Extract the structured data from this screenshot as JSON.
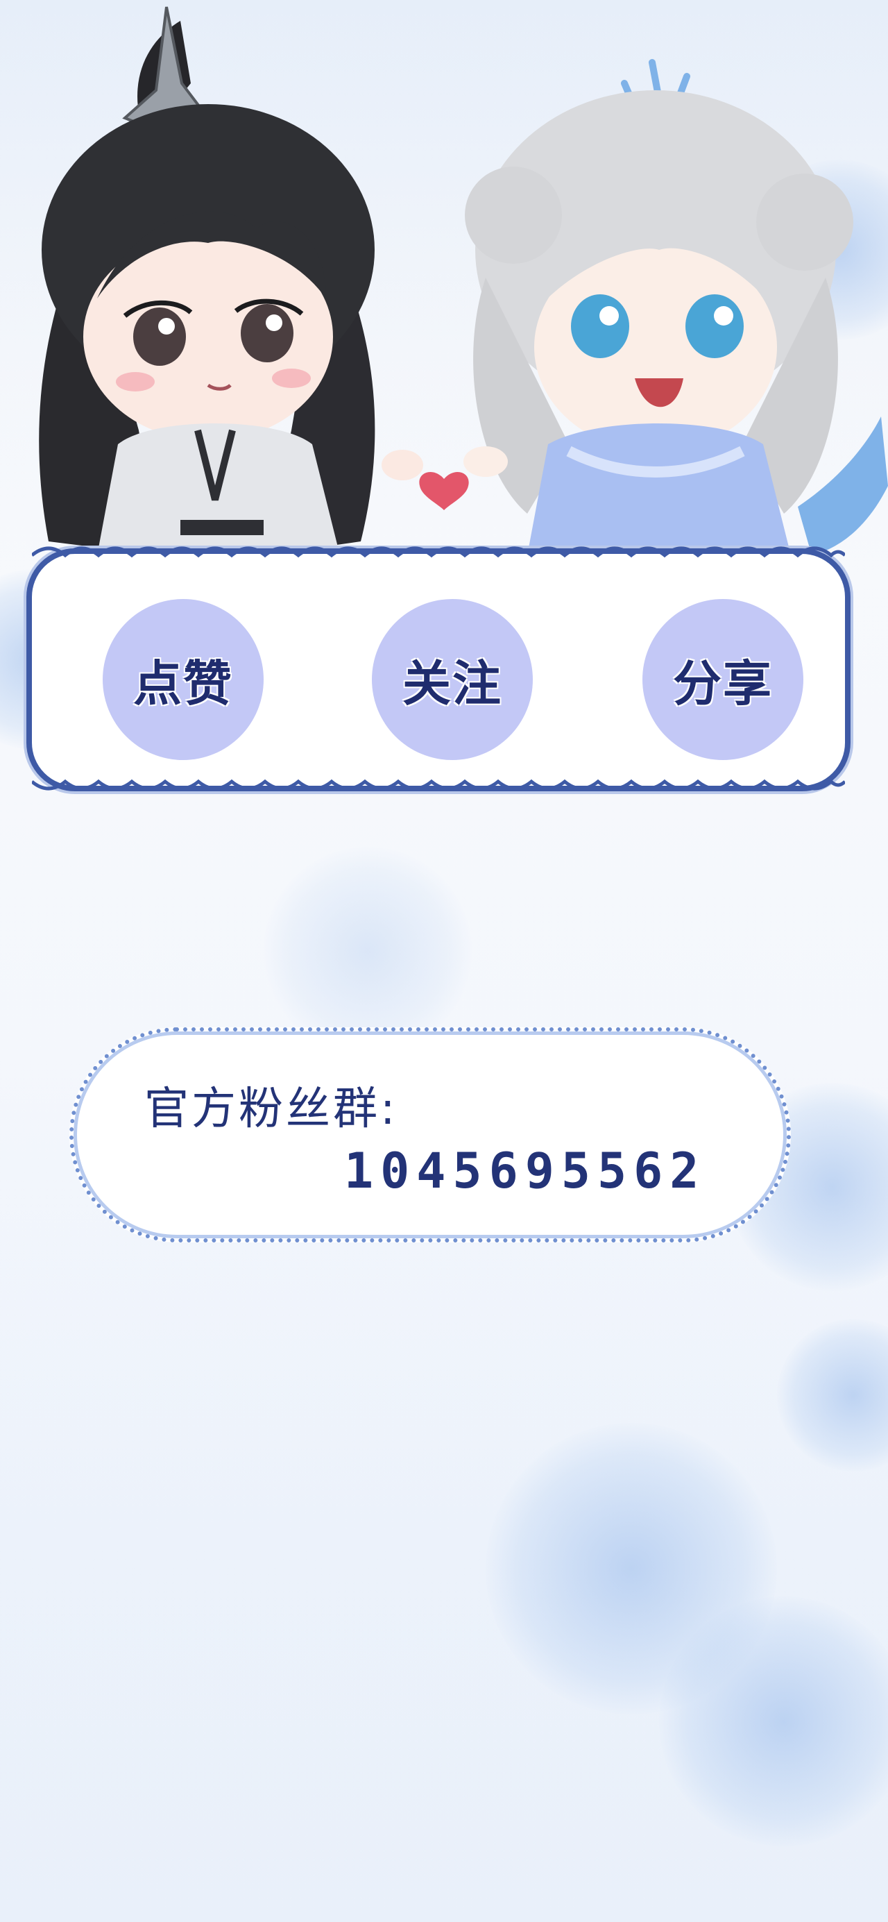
{
  "actions": {
    "like": "点赞",
    "follow": "关注",
    "share": "分享"
  },
  "fan_group": {
    "label": "官方粉丝群:",
    "number": "1045695562"
  },
  "colors": {
    "button_fill": "#c3c8f6",
    "text": "#1f2c6e",
    "frame": "#3e5aa6",
    "heart": "#e3566a"
  }
}
